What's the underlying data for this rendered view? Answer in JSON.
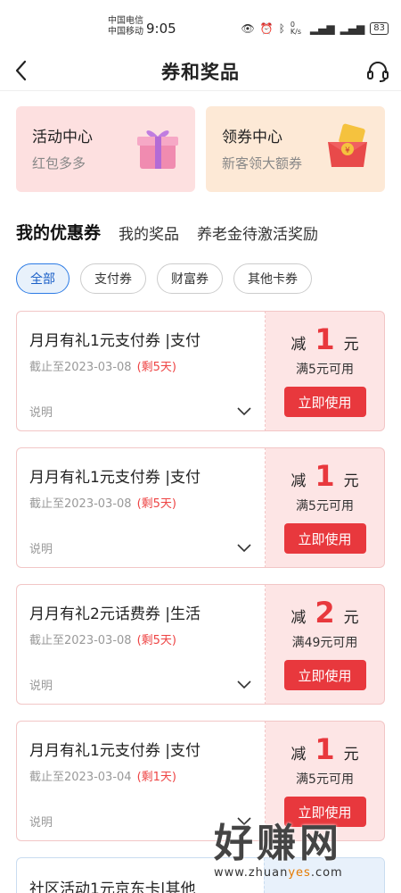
{
  "status": {
    "carrier1": "中国电信",
    "carrier2": "中国移动",
    "time": "9:05",
    "speed": "0 K/s",
    "battery": "83"
  },
  "nav": {
    "title": "券和奖品",
    "back_icon": "back-arrow-icon",
    "service_icon": "headset-icon"
  },
  "promo": [
    {
      "title": "活动中心",
      "subtitle": "红包多多",
      "icon": "gift-box-icon"
    },
    {
      "title": "领券中心",
      "subtitle": "新客领大额券",
      "icon": "red-envelope-icon"
    }
  ],
  "tabs": [
    {
      "label": "我的优惠券",
      "active": true
    },
    {
      "label": "我的奖品",
      "active": false
    },
    {
      "label": "养老金待激活奖励",
      "active": false
    }
  ],
  "filters": [
    {
      "label": "全部",
      "active": true
    },
    {
      "label": "支付券",
      "active": false
    },
    {
      "label": "财富券",
      "active": false
    },
    {
      "label": "其他卡券",
      "active": false
    }
  ],
  "coupons": [
    {
      "name": "月月有礼1元支付券 |支付",
      "expiry": "截止至2023-03-08",
      "remaining": "(剩5天)",
      "explain": "说明",
      "prefix": "减",
      "amount": "1",
      "unit": "元",
      "condition": "满5元可用",
      "button": "立即使用"
    },
    {
      "name": "月月有礼1元支付券 |支付",
      "expiry": "截止至2023-03-08",
      "remaining": "(剩5天)",
      "explain": "说明",
      "prefix": "减",
      "amount": "1",
      "unit": "元",
      "condition": "满5元可用",
      "button": "立即使用"
    },
    {
      "name": "月月有礼2元话费券 |生活",
      "expiry": "截止至2023-03-08",
      "remaining": "(剩5天)",
      "explain": "说明",
      "prefix": "减",
      "amount": "2",
      "unit": "元",
      "condition": "满49元可用",
      "button": "立即使用"
    },
    {
      "name": "月月有礼1元支付券 |支付",
      "expiry": "截止至2023-03-04",
      "remaining": "(剩1天)",
      "explain": "说明",
      "prefix": "减",
      "amount": "1",
      "unit": "元",
      "condition": "满5元可用",
      "button": "立即使用"
    }
  ],
  "last_coupon": {
    "name": "社区活动1元京东卡|其他"
  },
  "watermark": {
    "text": "好赚网",
    "url_prefix": "www.zhuan",
    "url_highlight": "yes",
    "url_suffix": ".com"
  },
  "colors": {
    "accent_red": "#e8383d",
    "active_blue": "#2c7be5"
  }
}
